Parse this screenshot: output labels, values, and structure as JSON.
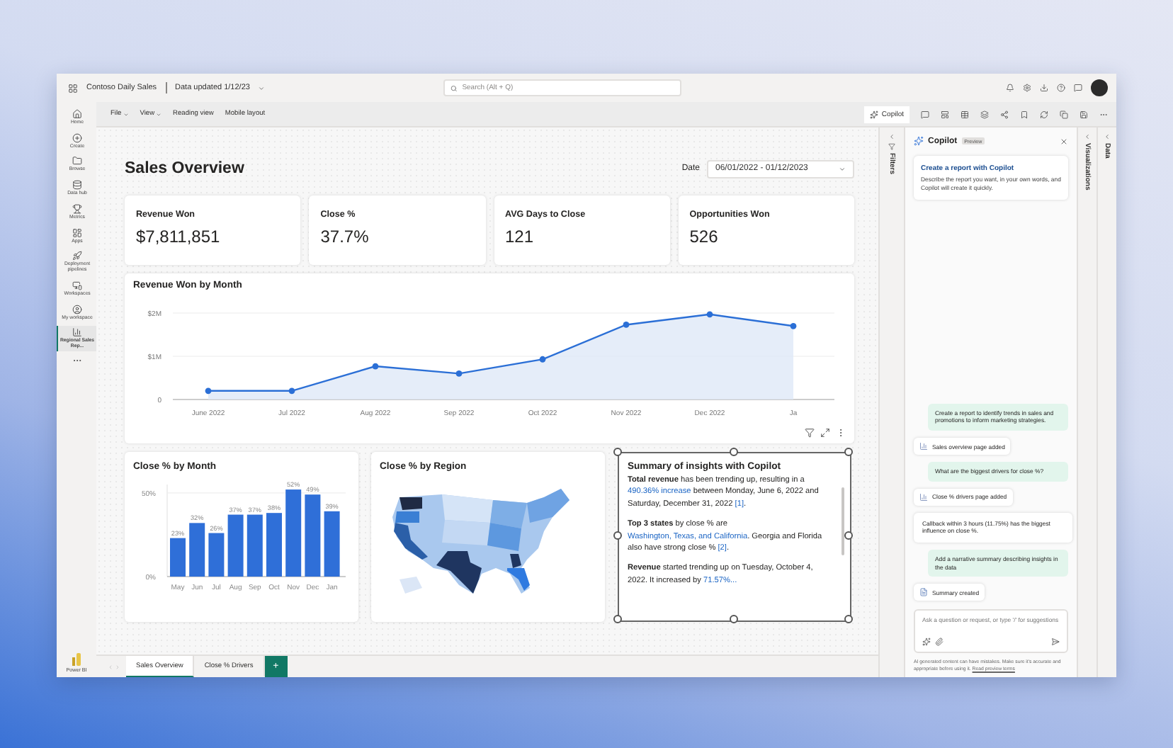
{
  "app": {
    "report_name": "Contoso Daily Sales",
    "data_updated": "Data updated 1/12/23",
    "search_placeholder": "Search (Alt + Q)"
  },
  "nav": [
    {
      "label": "Home",
      "selected": false
    },
    {
      "label": "Create",
      "selected": false
    },
    {
      "label": "Browse",
      "selected": false
    },
    {
      "label": "Data hub",
      "selected": false
    },
    {
      "label": "Metrics",
      "selected": false
    },
    {
      "label": "Apps",
      "selected": false
    },
    {
      "label": "Deployment pipelines",
      "selected": false
    },
    {
      "label": "Workspaces",
      "selected": false
    },
    {
      "label": "My workspace",
      "selected": false
    },
    {
      "label": "Regional Sales Rep...",
      "selected": true
    }
  ],
  "nav_footer": "Power BI",
  "menu": [
    {
      "label": "File",
      "dropdown": true
    },
    {
      "label": "View",
      "dropdown": true
    },
    {
      "label": "Reading view",
      "dropdown": false
    },
    {
      "label": "Mobile layout",
      "dropdown": false
    }
  ],
  "copilot_button": "Copilot",
  "page": {
    "title": "Sales Overview",
    "date_label": "Date",
    "date_value": "06/01/2022 - 01/12/2023"
  },
  "kpis": [
    {
      "label": "Revenue Won",
      "value": "$7,811,851"
    },
    {
      "label": "Close %",
      "value": "37.7%"
    },
    {
      "label": "AVG Days to Close",
      "value": "121"
    },
    {
      "label": "Opportunities Won",
      "value": "526"
    }
  ],
  "revenue_chart": {
    "title": "Revenue Won by Month",
    "chart_data": {
      "type": "area",
      "categories": [
        "June 2022",
        "Jul 2022",
        "Aug 2022",
        "Sep 2022",
        "Oct 2022",
        "Nov 2022",
        "Dec 2022",
        "Ja"
      ],
      "values": [
        0.2,
        0.2,
        0.77,
        0.6,
        0.93,
        1.73,
        1.97,
        1.7
      ],
      "ylim": [
        0,
        2
      ],
      "yticks": [
        {
          "value": 0,
          "label": "0"
        },
        {
          "value": 1,
          "label": "$1M"
        },
        {
          "value": 2,
          "label": "$2M"
        }
      ]
    }
  },
  "close_month_chart": {
    "title": "Close % by Month",
    "chart_data": {
      "type": "bar",
      "categories": [
        "May",
        "Jun",
        "Jul",
        "Aug",
        "Sep",
        "Oct",
        "Nov",
        "Dec",
        "Jan"
      ],
      "values": [
        23,
        32,
        26,
        37,
        37,
        38,
        52,
        49,
        39
      ],
      "ylim": [
        0,
        55
      ],
      "yticks": [
        {
          "value": 0,
          "label": "0%"
        },
        {
          "value": 50,
          "label": "50%"
        }
      ],
      "value_labels": [
        "23%",
        "32%",
        "26%",
        "37%",
        "37%",
        "38%",
        "52%",
        "49%",
        "39%"
      ]
    }
  },
  "region_map": {
    "title": "Close % by Region"
  },
  "summary": {
    "title": "Summary of insights with Copilot",
    "selected": true,
    "paragraphs": [
      [
        {
          "text": "Total revenue",
          "kind": "bold"
        },
        {
          "text": " has been trending up, resulting in a ",
          "kind": "plain"
        },
        {
          "text": "490.36% increase",
          "kind": "link"
        },
        {
          "text": " between Monday, June 6, 2022 and Saturday, December 31, 2022 ",
          "kind": "plain"
        },
        {
          "text": "[1]",
          "kind": "link"
        },
        {
          "text": ".",
          "kind": "plain"
        }
      ],
      [
        {
          "text": "Top 3 states",
          "kind": "bold"
        },
        {
          "text": " by close % are ",
          "kind": "plain"
        },
        {
          "text": "Washington, Texas, and California",
          "kind": "link"
        },
        {
          "text": ". Georgia and Florida also have strong close % ",
          "kind": "plain"
        },
        {
          "text": "[2]",
          "kind": "link"
        },
        {
          "text": ".",
          "kind": "plain"
        }
      ],
      [
        {
          "text": "Revenue",
          "kind": "bold"
        },
        {
          "text": " started trending up on Tuesday, October 4, 2022. It increased by ",
          "kind": "plain"
        },
        {
          "text": "71.57%...",
          "kind": "link"
        }
      ]
    ]
  },
  "panes": {
    "filters": "Filters",
    "visualizations": "Visualizations",
    "data": "Data"
  },
  "copilot": {
    "title": "Copilot",
    "badge": "Preview",
    "intro_title": "Create a report with Copilot",
    "intro_text": "Describe the report you want, in your own words, and Copilot will create it quickly.",
    "messages": [
      {
        "kind": "user",
        "text": "Create a report to identify trends in sales and promotions to inform marketing strategies."
      },
      {
        "kind": "page_added",
        "text": "Sales overview page added"
      },
      {
        "kind": "user",
        "text": "What are the biggest drivers for close %?"
      },
      {
        "kind": "page_added",
        "text": "Close % drivers page added"
      },
      {
        "kind": "reply",
        "text": "Callback within 3 hours (11.75%) has the biggest influence on close %."
      },
      {
        "kind": "user",
        "text": "Add a narrative summary describing insights in the data"
      },
      {
        "kind": "summary_created",
        "text": "Summary created"
      }
    ],
    "input_placeholder": "Ask a question or request, or type '/' for suggestions",
    "disclaimer": "AI generated content can have mistakes. Make sure it's accurate and appropriate before using it.",
    "disclaimer_link": "Read preview terms"
  },
  "bottom_tabs": [
    {
      "label": "Sales Overview",
      "selected": true
    },
    {
      "label": "Close % Drivers",
      "selected": false
    }
  ],
  "add_tab": "+"
}
